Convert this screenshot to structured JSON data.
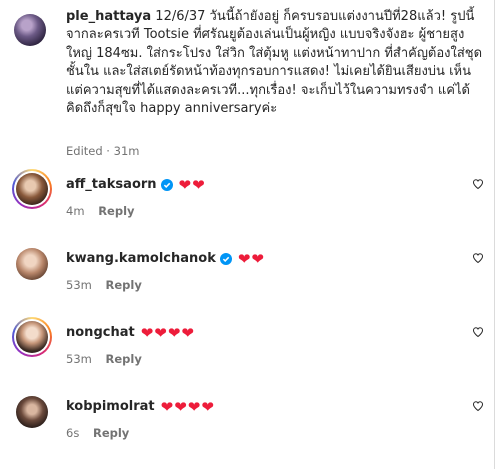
{
  "caption": {
    "username": "ple_hattaya",
    "text": "12/6/37 วันนี้ถ้ายังอยู่ ก็ครบรอบแต่งงานปีที่28แล้ว! รูปนี้จากละครเวที Tootsie ที่ศรัณยูต้องเล่นเป็นผู้หญิง แบบจริงจังฮะ ผู้ชายสูงใหญ่ 184ซม. ใส่กระโปรง ใส่วิก ใส่ตุ้มหู แต่งหน้าทาปาก ที่สำคัญต้องใส่ชุดชั้นใน และใส่สเตย์รัดหน้าท้องทุกรอบการแสดง! ไม่เคยได้ยินเสียงบ่น เห็นแต่ความสุขที่ได้แสดงละครเวที...ทุกเรื่อง! จะเก็บไว้ในความทรงจำ แค่ได้คิดถึงก็สุขใจ happy anniversaryค่ะ",
    "edited_label": "Edited",
    "time": "31m"
  },
  "comments": [
    {
      "username": "aff_taksaorn",
      "verified": true,
      "text": "❤️❤️",
      "hearts": "❤❤",
      "time": "4m",
      "reply_label": "Reply",
      "story_ring": true
    },
    {
      "username": "kwang.kamolchanok",
      "verified": true,
      "text": "❤️❤️",
      "hearts": "❤❤",
      "time": "53m",
      "reply_label": "Reply",
      "story_ring": false
    },
    {
      "username": "nongchat",
      "verified": false,
      "text": "❤️❤️❤️❤️",
      "hearts": "❤❤❤❤",
      "time": "53m",
      "reply_label": "Reply",
      "story_ring": true
    },
    {
      "username": "kobpimolrat",
      "verified": false,
      "text": "❤️❤️❤️❤️",
      "hearts": "❤❤❤❤",
      "time": "6s",
      "reply_label": "Reply",
      "story_ring": false
    }
  ],
  "colors": {
    "heart": "#ed1c3a",
    "verified": "#0095f6",
    "meta_text": "#737373"
  },
  "icons": {
    "verified": "verified-badge-icon",
    "like": "heart-outline-icon"
  }
}
